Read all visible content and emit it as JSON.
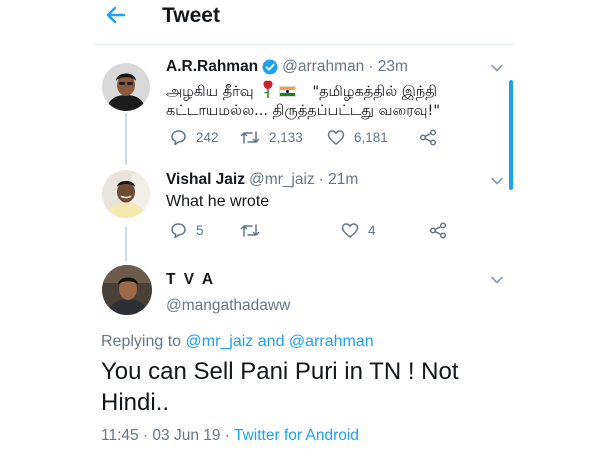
{
  "header": {
    "title": "Tweet"
  },
  "tweets": [
    {
      "display_name": "A.R.Rahman",
      "verified": true,
      "handle": "@arrahman",
      "time": "· 23m",
      "text_line1_a": "அழகிய தீர்வு",
      "text_line1_b": "\"தமிழகத்தில் இந்தி",
      "text_line2": "கட்டாயமல்ல... திருத்தப்பட்டது வரைவு!\"",
      "replies": "242",
      "retweets": "2,133",
      "likes": "6,181"
    },
    {
      "display_name": "Vishal Jaiz",
      "handle": "@mr_jaiz",
      "time": "· 21m",
      "text": "What he wrote",
      "replies": "5",
      "retweets": "",
      "likes": "4"
    }
  ],
  "main_tweet": {
    "display_name": "T V A",
    "handle": "@mangathadaww",
    "replying_prefix": "Replying to",
    "replying_user1": "@mr_jaiz",
    "replying_and": "and",
    "replying_user2": "@arrahman",
    "text": "You can Sell Pani Puri in TN ! Not Hindi..",
    "time": "11:45 · 03 Jun 19 ·",
    "source": "Twitter for Android"
  },
  "icons": {
    "back": "arrow-left-icon",
    "verified": "verified-badge-icon",
    "more": "chevron-down-icon",
    "reply": "reply-icon",
    "retweet": "retweet-icon",
    "like": "heart-icon",
    "share": "share-icon",
    "rose": "rose-emoji",
    "flag": "india-flag-emoji"
  },
  "colors": {
    "accent": "#1da1f2",
    "secondary_text": "#657786"
  }
}
